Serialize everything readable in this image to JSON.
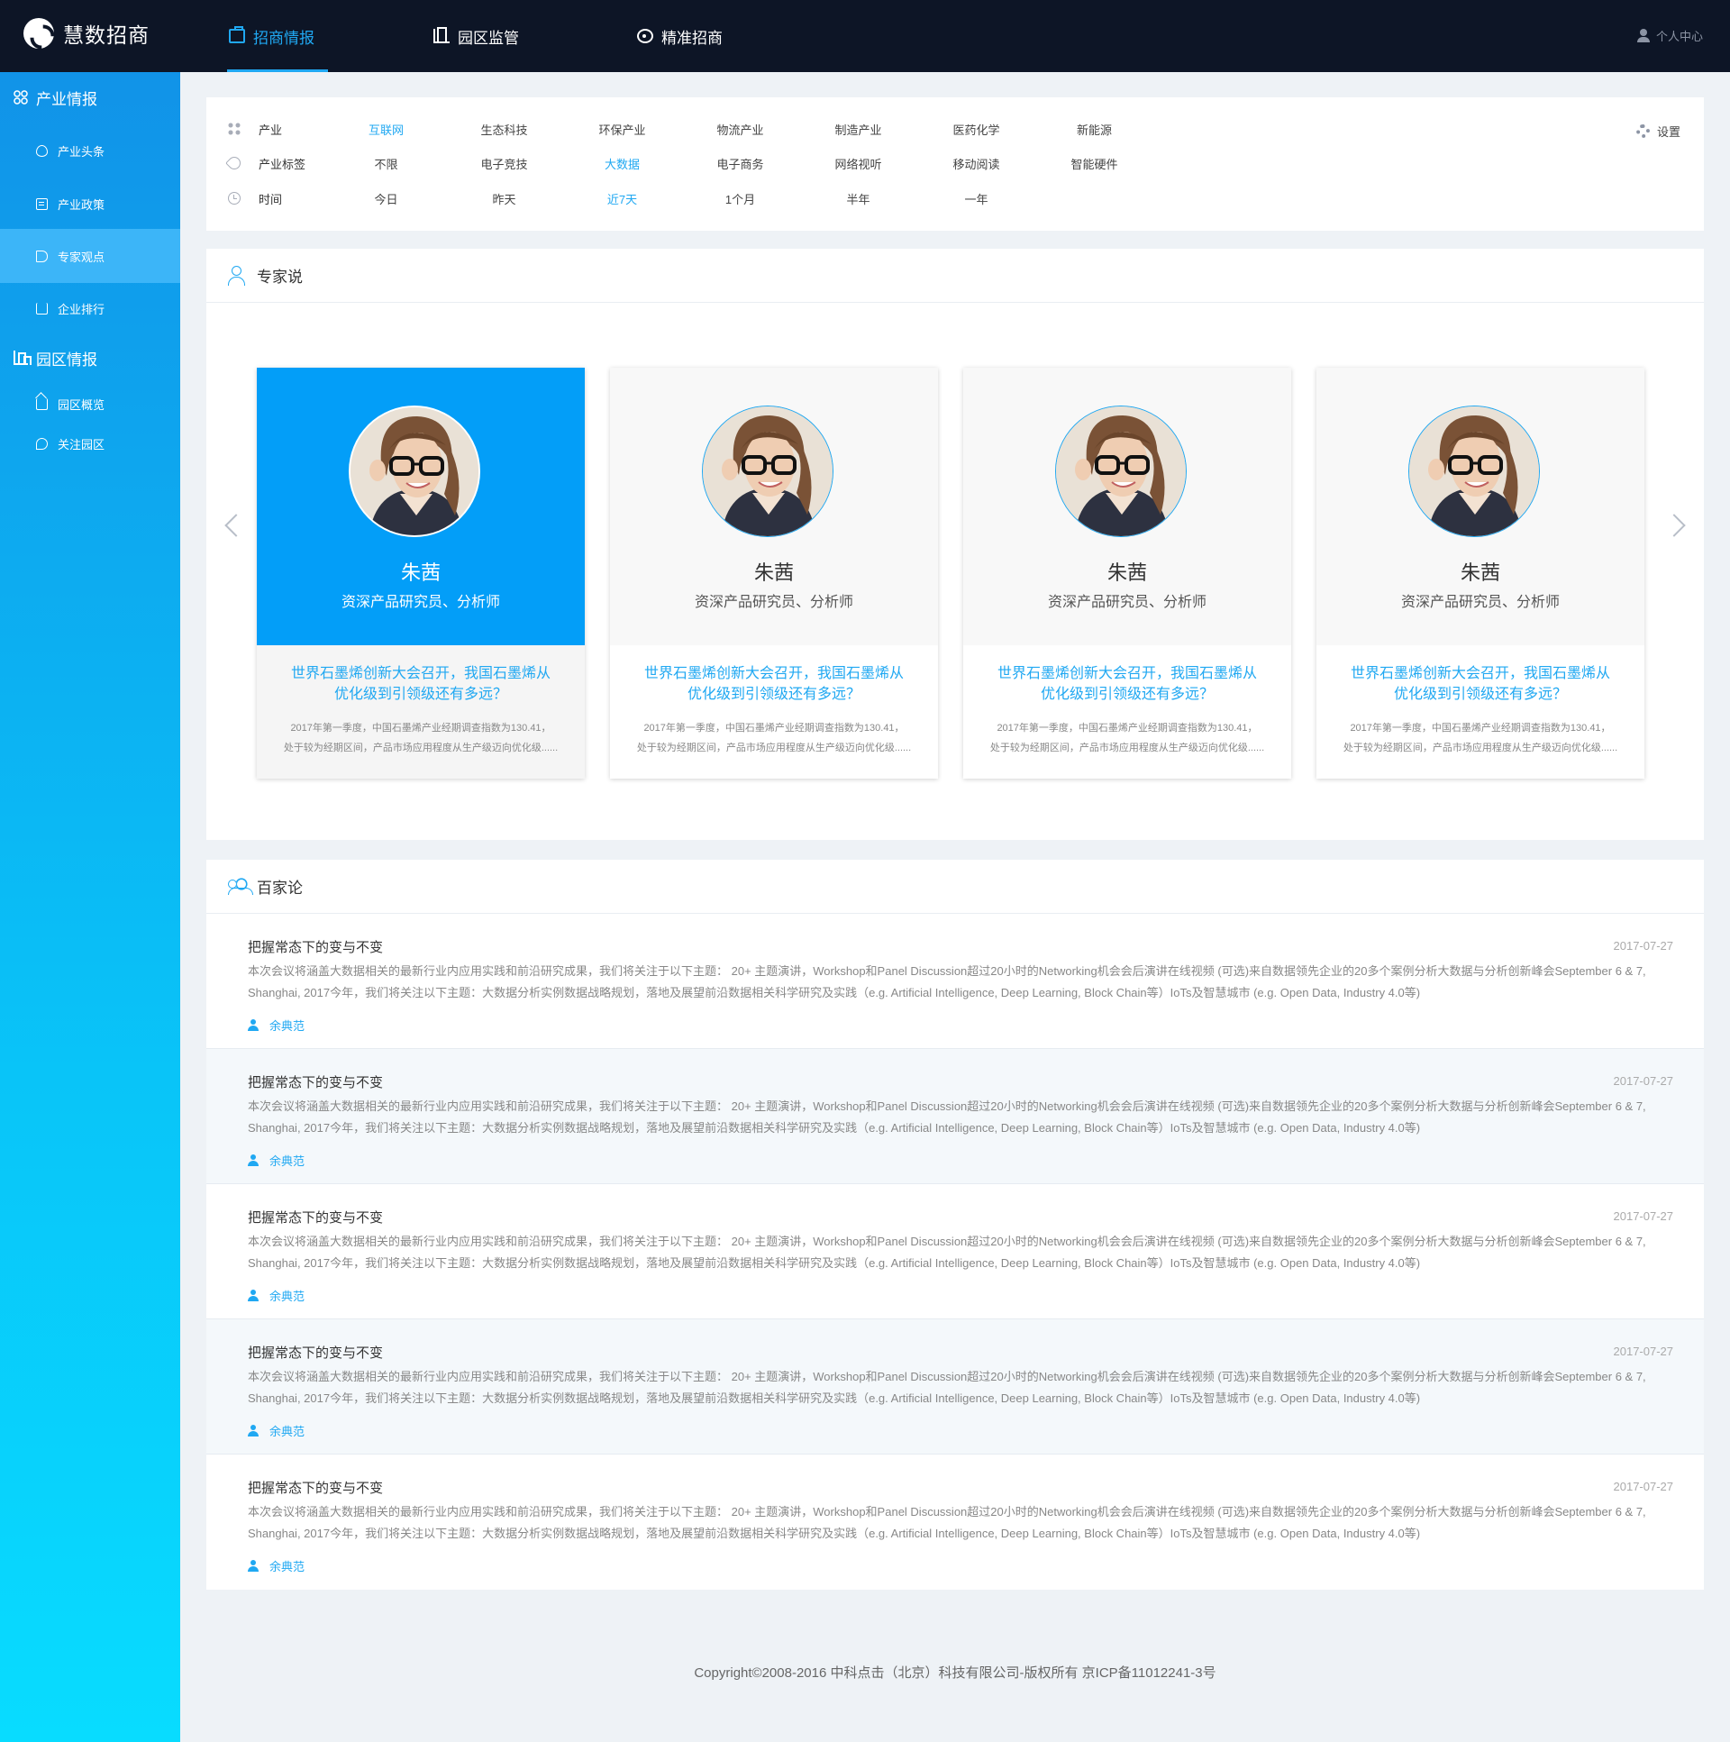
{
  "app": {
    "name": "慧数招商"
  },
  "nav": {
    "items": [
      {
        "label": "招商情报",
        "icon": "briefcase-icon",
        "active": true
      },
      {
        "label": "园区监管",
        "icon": "building-icon",
        "active": false
      },
      {
        "label": "精准招商",
        "icon": "target-icon",
        "active": false
      }
    ],
    "user_center": "个人中心"
  },
  "sidebar": {
    "group1": {
      "label": "产业情报",
      "icon": "grid-icon"
    },
    "items1": [
      {
        "label": "产业头条",
        "icon": "fire-icon"
      },
      {
        "label": "产业政策",
        "icon": "document-icon"
      },
      {
        "label": "专家观点",
        "icon": "speaker-icon",
        "active": true
      },
      {
        "label": "企业排行",
        "icon": "crown-icon"
      }
    ],
    "group2": {
      "label": "园区情报",
      "icon": "building-icon"
    },
    "items2": [
      {
        "label": "园区概览",
        "icon": "home-icon"
      },
      {
        "label": "关注园区",
        "icon": "heart-icon"
      }
    ]
  },
  "filters": {
    "industry": {
      "label": "产业",
      "options": [
        "互联网",
        "生态科技",
        "环保产业",
        "物流产业",
        "制造产业",
        "医药化学",
        "新能源"
      ],
      "selected": "互联网"
    },
    "tags": {
      "label": "产业标签",
      "options": [
        "不限",
        "电子竞技",
        "大数据",
        "电子商务",
        "网络视听",
        "移动阅读",
        "智能硬件"
      ],
      "selected": "大数据"
    },
    "time": {
      "label": "时间",
      "options": [
        "今日",
        "昨天",
        "近7天",
        "1个月",
        "半年",
        "一年"
      ],
      "selected": "近7天"
    },
    "settings_label": "设置"
  },
  "experts": {
    "title": "专家说",
    "cards": [
      {
        "name": "朱茜",
        "title": "资深产品研究员、分析师",
        "headline1": "世界石墨烯创新大会召开，我国石墨烯从",
        "headline2": "优化级到引领级还有多远？",
        "summary1": "2017年第一季度，中国石墨烯产业经期调查指数为130.41，",
        "summary2": "处于较为经期区间，产品市场应用程度从生产级迈向优化级......",
        "active": true
      },
      {
        "name": "朱茜",
        "title": "资深产品研究员、分析师",
        "headline1": "世界石墨烯创新大会召开，我国石墨烯从",
        "headline2": "优化级到引领级还有多远？",
        "summary1": "2017年第一季度，中国石墨烯产业经期调查指数为130.41，",
        "summary2": "处于较为经期区间，产品市场应用程度从生产级迈向优化级......",
        "active": false
      },
      {
        "name": "朱茜",
        "title": "资深产品研究员、分析师",
        "headline1": "世界石墨烯创新大会召开，我国石墨烯从",
        "headline2": "优化级到引领级还有多远？",
        "summary1": "2017年第一季度，中国石墨烯产业经期调查指数为130.41，",
        "summary2": "处于较为经期区间，产品市场应用程度从生产级迈向优化级......",
        "active": false
      },
      {
        "name": "朱茜",
        "title": "资深产品研究员、分析师",
        "headline1": "世界石墨烯创新大会召开，我国石墨烯从",
        "headline2": "优化级到引领级还有多远？",
        "summary1": "2017年第一季度，中国石墨烯产业经期调查指数为130.41，",
        "summary2": "处于较为经期区间，产品市场应用程度从生产级迈向优化级......",
        "active": false
      }
    ]
  },
  "baijia": {
    "title": "百家论",
    "articles": [
      {
        "title": "把握常态下的变与不变",
        "date": "2017-07-27",
        "body": "本次会议将涵盖大数据相关的最新行业内应用实践和前沿研究成果，我们将关注于以下主题： 20+ 主题演讲，Workshop和Panel Discussion超过20小时的Networking机会会后演讲在线视频 (可选)来自数据领先企业的20多个案例分析大数据与分析创新峰会September 6 & 7, Shanghai, 2017今年，我们将关注以下主题：大数据分析实例数据战略规划，落地及展望前沿数据相关科学研究及实践（e.g. Artificial Intelligence, Deep Learning, Block Chain等）IoTs及智慧城市 (e.g. Open Data, Industry 4.0等)",
        "author": "余典范"
      },
      {
        "title": "把握常态下的变与不变",
        "date": "2017-07-27",
        "body": "本次会议将涵盖大数据相关的最新行业内应用实践和前沿研究成果，我们将关注于以下主题： 20+ 主题演讲，Workshop和Panel Discussion超过20小时的Networking机会会后演讲在线视频 (可选)来自数据领先企业的20多个案例分析大数据与分析创新峰会September 6 & 7, Shanghai, 2017今年，我们将关注以下主题：大数据分析实例数据战略规划，落地及展望前沿数据相关科学研究及实践（e.g. Artificial Intelligence, Deep Learning, Block Chain等）IoTs及智慧城市 (e.g. Open Data, Industry 4.0等)",
        "author": "余典范"
      },
      {
        "title": "把握常态下的变与不变",
        "date": "2017-07-27",
        "body": "本次会议将涵盖大数据相关的最新行业内应用实践和前沿研究成果，我们将关注于以下主题： 20+ 主题演讲，Workshop和Panel Discussion超过20小时的Networking机会会后演讲在线视频 (可选)来自数据领先企业的20多个案例分析大数据与分析创新峰会September 6 & 7, Shanghai, 2017今年，我们将关注以下主题：大数据分析实例数据战略规划，落地及展望前沿数据相关科学研究及实践（e.g. Artificial Intelligence, Deep Learning, Block Chain等）IoTs及智慧城市 (e.g. Open Data, Industry 4.0等)",
        "author": "余典范"
      },
      {
        "title": "把握常态下的变与不变",
        "date": "2017-07-27",
        "body": "本次会议将涵盖大数据相关的最新行业内应用实践和前沿研究成果，我们将关注于以下主题： 20+ 主题演讲，Workshop和Panel Discussion超过20小时的Networking机会会后演讲在线视频 (可选)来自数据领先企业的20多个案例分析大数据与分析创新峰会September 6 & 7, Shanghai, 2017今年，我们将关注以下主题：大数据分析实例数据战略规划，落地及展望前沿数据相关科学研究及实践（e.g. Artificial Intelligence, Deep Learning, Block Chain等）IoTs及智慧城市 (e.g. Open Data, Industry 4.0等)",
        "author": "余典范"
      },
      {
        "title": "把握常态下的变与不变",
        "date": "2017-07-27",
        "body": "本次会议将涵盖大数据相关的最新行业内应用实践和前沿研究成果，我们将关注于以下主题： 20+ 主题演讲，Workshop和Panel Discussion超过20小时的Networking机会会后演讲在线视频 (可选)来自数据领先企业的20多个案例分析大数据与分析创新峰会September 6 & 7, Shanghai, 2017今年，我们将关注以下主题：大数据分析实例数据战略规划，落地及展望前沿数据相关科学研究及实践（e.g. Artificial Intelligence, Deep Learning, Block Chain等）IoTs及智慧城市 (e.g. Open Data, Industry 4.0等)",
        "author": "余典范"
      }
    ]
  },
  "footer": {
    "text": "Copyright©2008-2016 中科点击（北京）科技有限公司-版权所有   京ICP备11012241-3号"
  },
  "colors": {
    "accent": "#20a8f2",
    "topbar": "#0d1526",
    "active_card": "#039ef8"
  }
}
